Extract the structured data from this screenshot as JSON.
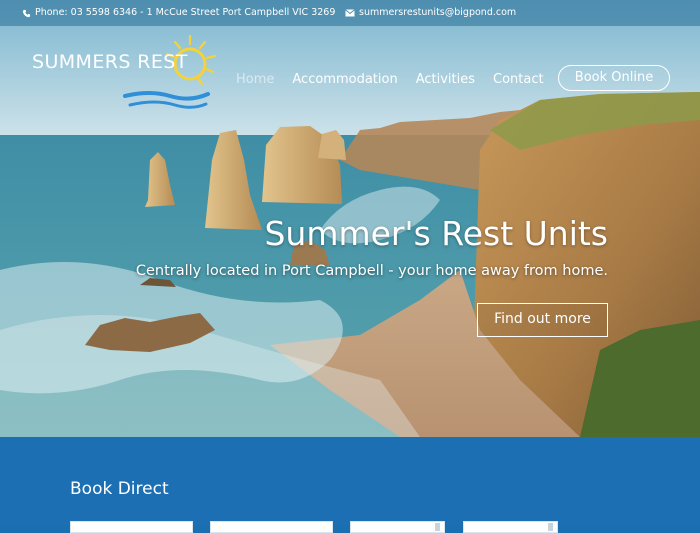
{
  "topbar": {
    "phone": "Phone: 03 5598 6346 - 1 McCue Street Port Campbell VIC 3269",
    "email": "summersrestunits@bigpond.com"
  },
  "logo": {
    "text": "SUMMERS REST"
  },
  "nav": {
    "items": [
      "Home",
      "Accommodation",
      "Activities",
      "Contact"
    ],
    "book_label": "Book Online"
  },
  "hero": {
    "title": "Summer's Rest Units",
    "subtitle": "Centrally located in Port Campbell - your home away from home.",
    "cta": "Find out more"
  },
  "book_direct": {
    "title": "Book Direct"
  },
  "colors": {
    "accent": "#1c6fb3",
    "sun": "#f5d23a",
    "wave": "#2f8fd8",
    "white": "#ffffff"
  }
}
